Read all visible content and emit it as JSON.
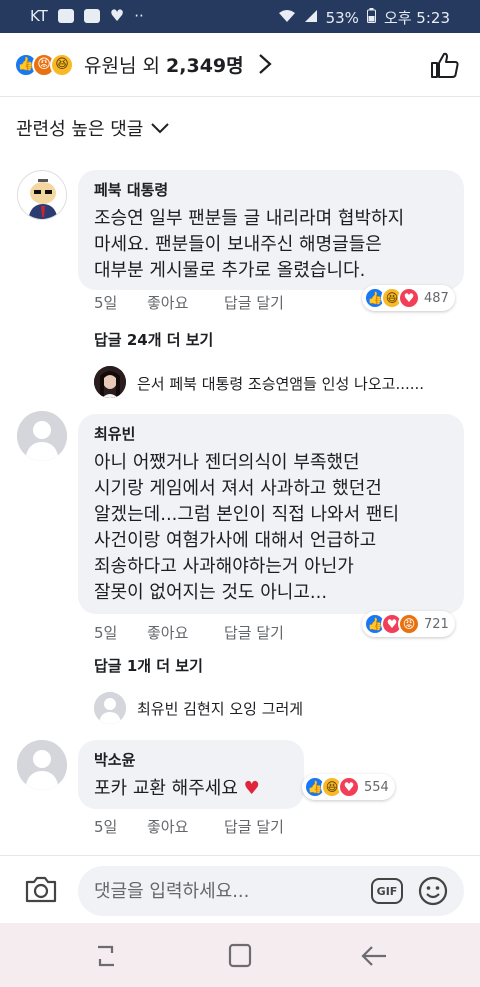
{
  "status_bar": {
    "carrier": "KT",
    "more": "··",
    "battery": "53%",
    "time": "오후 5:23"
  },
  "header": {
    "reacted_name": "유원님",
    "reacted_connector": "외",
    "reacted_count": "2,349명",
    "reactions": [
      "like",
      "angry",
      "haha"
    ]
  },
  "sort": {
    "label": "관련성 높은 댓글"
  },
  "comments": [
    {
      "author": "페북 대통령",
      "text": "조승연 일부 팬분들 글 내리라며 협박하지\n마세요. 팬분들이 보내주신 해명글들은\n대부분 게시물로 추가로 올렸습니다.",
      "time": "5일",
      "like_label": "좋아요",
      "reply_label": "답글 달기",
      "reactions": [
        "like",
        "haha",
        "love"
      ],
      "reaction_count": "487",
      "more_replies": "답글 24개 더 보기",
      "reply_preview": "은서 페북 대통령 조승연앰들 인성 나오고......"
    },
    {
      "author": "최유빈",
      "text": "아니 어쨌거나 젠더의식이 부족했던\n시기랑 게임에서 져서 사과하고 했던건\n알겠는데...그럼 본인이 직접 나와서 팬티\n사건이랑 여혐가사에 대해서 언급하고\n죄송하다고 사과해야하는거 아닌가\n잘못이 없어지는 것도 아니고...",
      "time": "5일",
      "like_label": "좋아요",
      "reply_label": "답글 달기",
      "reactions": [
        "like",
        "love",
        "angry"
      ],
      "reaction_count": "721",
      "more_replies": "답글 1개 더 보기",
      "reply_preview": "최유빈 김현지 오잉 그러게"
    },
    {
      "author": "박소윤",
      "text": "포카 교환 해주세요",
      "time": "5일",
      "like_label": "좋아요",
      "reply_label": "답글 달기",
      "reactions": [
        "like",
        "haha",
        "love"
      ],
      "reaction_count": "554"
    }
  ],
  "composer": {
    "placeholder": "댓글을 입력하세요...",
    "gif_label": "GIF"
  },
  "colors": {
    "status_bar": "#253a5e",
    "bubble": "#f0f2f5",
    "like": "#1877f2",
    "love": "#f33e58",
    "haha": "#f7b928",
    "angry": "#e9710f",
    "nav_bar": "#f5ecf0"
  }
}
